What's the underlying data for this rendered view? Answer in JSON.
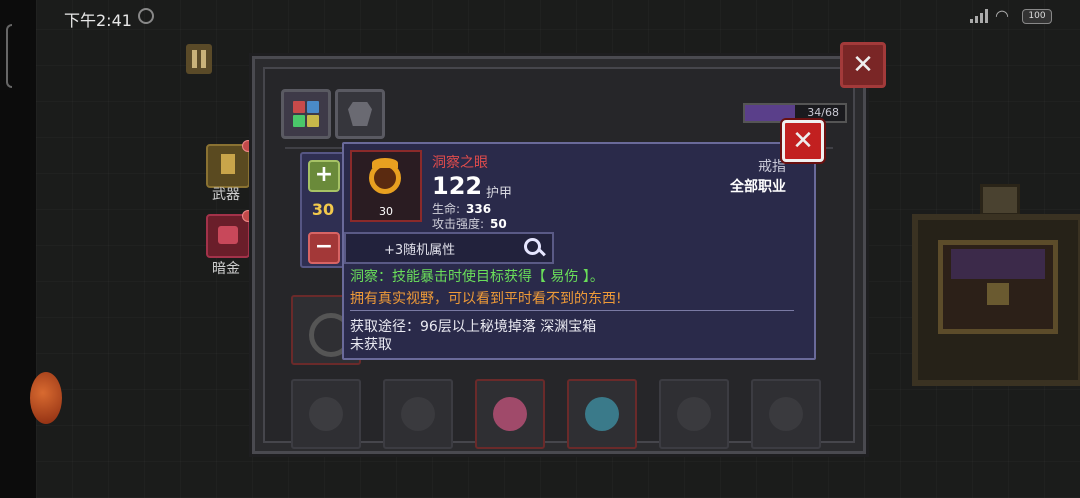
{
  "status_bar": {
    "time": "下午2:41",
    "battery": "100"
  },
  "side_menu": {
    "weapon_label": "武器",
    "dark_gold_label": "暗金"
  },
  "inventory": {
    "capacity_text": "34/68",
    "capacity_fraction": 0.5,
    "colors": {
      "panel_bg": "#2b2b2e",
      "capacity_fill": "#5a3f8a"
    }
  },
  "stepper": {
    "value": "30"
  },
  "item": {
    "name": "洞察之眼",
    "power": "122",
    "power_unit": "护甲",
    "quantity": "30",
    "stats": [
      {
        "label": "生命:",
        "value": "336"
      },
      {
        "label": "攻击强度:",
        "value": "50"
      }
    ],
    "slot_type": "戒指",
    "class": "全部职业",
    "random_attrs": "+3随机属性",
    "effect_special": "洞察：技能暴击时使目标获得【 易伤 】。",
    "effect_desc": "拥有真实视野，可以看到平时看不到的东西!",
    "source": "获取途径：96层以上秘境掉落 深渊宝箱",
    "acquired_status": "未获取",
    "colors": {
      "name": "#e04c4c",
      "special": "#6adf5a",
      "desc": "#ee9a38",
      "rarity_border": "#8a2a2a"
    }
  },
  "icons": {
    "close": "✕",
    "plus": "+",
    "minus": "−"
  }
}
